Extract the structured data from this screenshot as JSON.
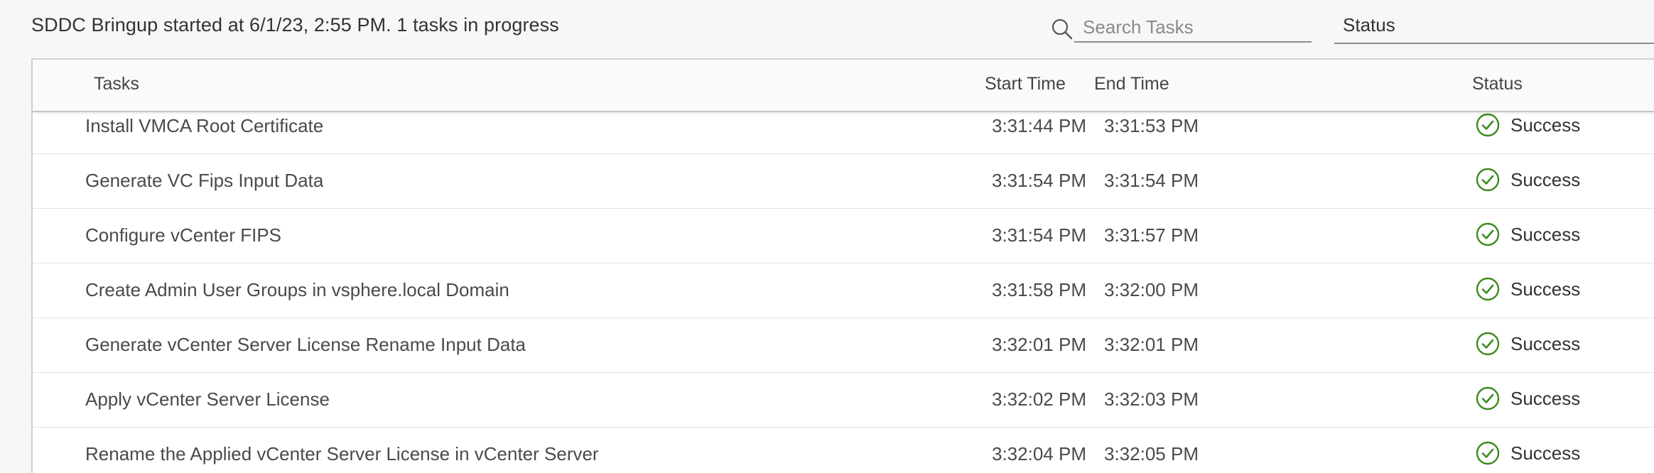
{
  "header": {
    "summary": "SDDC Bringup started at 6/1/23, 2:55 PM. 1 tasks in progress",
    "search": {
      "placeholder": "Search Tasks",
      "value": ""
    },
    "status_filter": {
      "label": "Status"
    },
    "icons": {
      "search": "search-icon"
    }
  },
  "table": {
    "columns": {
      "tasks": "Tasks",
      "start_time": "Start Time",
      "end_time": "End Time",
      "status": "Status"
    },
    "rows": [
      {
        "task": "Install VMCA Root Certificate",
        "start": "3:31:44 PM",
        "end": "3:31:53 PM",
        "status": "Success"
      },
      {
        "task": "Generate VC Fips Input Data",
        "start": "3:31:54 PM",
        "end": "3:31:54 PM",
        "status": "Success"
      },
      {
        "task": "Configure vCenter FIPS",
        "start": "3:31:54 PM",
        "end": "3:31:57 PM",
        "status": "Success"
      },
      {
        "task": "Create Admin User Groups in vsphere.local Domain",
        "start": "3:31:58 PM",
        "end": "3:32:00 PM",
        "status": "Success"
      },
      {
        "task": "Generate vCenter Server License Rename Input Data",
        "start": "3:32:01 PM",
        "end": "3:32:01 PM",
        "status": "Success"
      },
      {
        "task": "Apply vCenter Server License",
        "start": "3:32:02 PM",
        "end": "3:32:03 PM",
        "status": "Success"
      },
      {
        "task": "Rename the Applied vCenter Server License in vCenter Server",
        "start": "3:32:04 PM",
        "end": "3:32:05 PM",
        "status": "Success"
      }
    ]
  },
  "colors": {
    "success": "#3d8b1f",
    "text": "#333333",
    "border": "#cfcfcf"
  }
}
